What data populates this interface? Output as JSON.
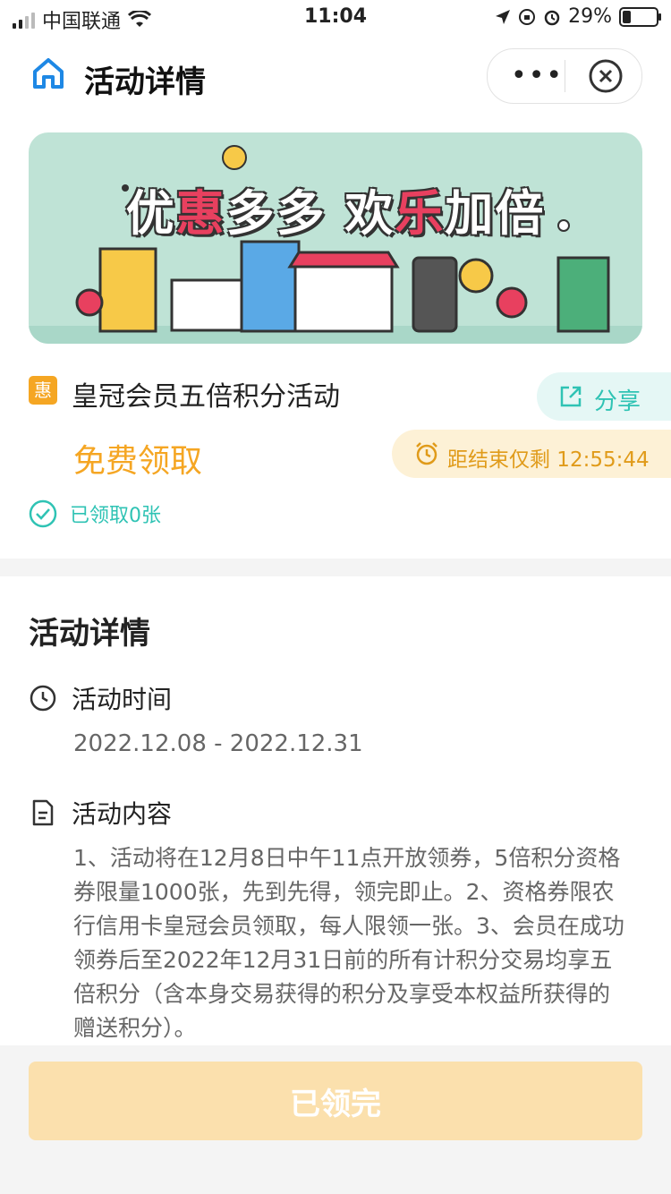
{
  "status_bar": {
    "carrier": "中国联通",
    "time": "11:04",
    "battery": "29%"
  },
  "nav": {
    "title": "活动详情",
    "more_label": "•••"
  },
  "banner": {
    "text_1": "优",
    "text_hl": "惠",
    "text_2": "多多 欢",
    "text_hl2": "乐",
    "text_3": "加倍"
  },
  "activity": {
    "badge": "惠",
    "title": "皇冠会员五倍积分活动",
    "share_label": "分享",
    "price": "免费领取",
    "countdown": "距结束仅剩 12:55:44",
    "claimed": "已领取0张"
  },
  "details": {
    "heading": "活动详情",
    "time_label": "活动时间",
    "time_range": "2022.12.08 - 2022.12.31",
    "content_label": "活动内容",
    "content_text": "1、活动将在12月8日中午11点开放领券，5倍积分资格券限量1000张，先到先得，领完即止。2、资格券限农行信用卡皇冠会员领取，每人限领一张。3、会员在成功领券后至2022年12月31日前的所有计积分交易均享五倍积分（含本身交易获得的积分及享受本权益所获得的赠送积分）。"
  },
  "footer": {
    "button_label": "已领完"
  },
  "colors": {
    "accent_orange": "#f5a623",
    "accent_teal": "#2fc3b4",
    "banner_bg": "#bfe3d6"
  }
}
